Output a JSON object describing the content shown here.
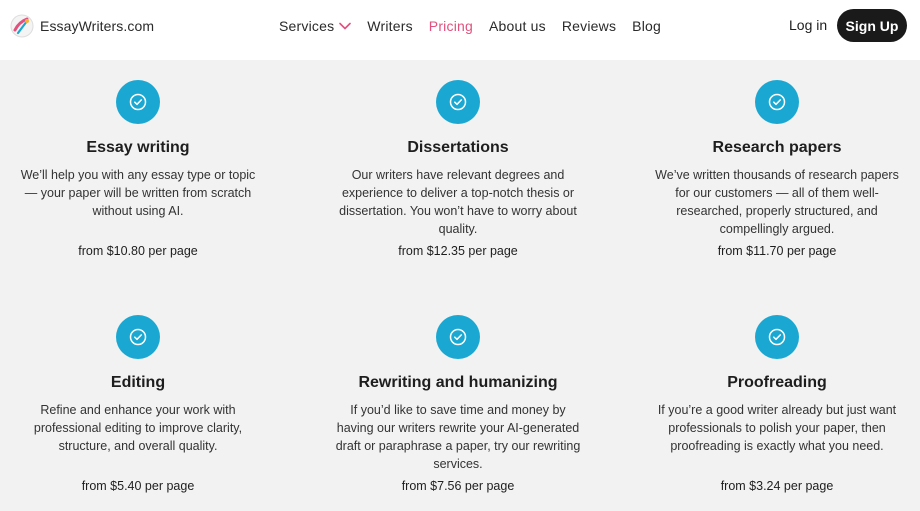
{
  "header": {
    "brand": "EssayWriters.com",
    "nav": [
      {
        "label": "Services",
        "has_dropdown": true,
        "active": false
      },
      {
        "label": "Writers",
        "has_dropdown": false,
        "active": false
      },
      {
        "label": "Pricing",
        "has_dropdown": false,
        "active": true
      },
      {
        "label": "About us",
        "has_dropdown": false,
        "active": false
      },
      {
        "label": "Reviews",
        "has_dropdown": false,
        "active": false
      },
      {
        "label": "Blog",
        "has_dropdown": false,
        "active": false
      }
    ],
    "login_label": "Log in",
    "signup_label": "Sign Up"
  },
  "colors": {
    "accent_pink": "#e2517e",
    "icon_blue": "#1aa8d2",
    "background": "#f2f2f2",
    "button_dark": "#1a1a1a"
  },
  "services": [
    {
      "title": "Essay writing",
      "description": "We’ll help you with any essay type or topic — your paper will be written from scratch without using AI.",
      "price": "from $10.80 per page",
      "icon": "check-circle-icon"
    },
    {
      "title": "Dissertations",
      "description": "Our writers have relevant degrees and experience to deliver a top-notch thesis or dissertation. You won’t have to worry about quality.",
      "price": "from $12.35 per page",
      "icon": "check-circle-icon"
    },
    {
      "title": "Research papers",
      "description": "We’ve written thousands of research papers for our customers — all of them well-researched, properly structured, and compellingly argued.",
      "price": "from $11.70 per page",
      "icon": "check-circle-icon"
    },
    {
      "title": "Editing",
      "description": "Refine and enhance your work with professional editing to improve clarity, structure, and overall quality.",
      "price": "from $5.40 per page",
      "icon": "check-circle-icon"
    },
    {
      "title": "Rewriting and humanizing",
      "description": "If you’d like to save time and money by having our writers rewrite your AI-generated draft or paraphrase a paper, try our rewriting services.",
      "price": "from $7.56 per page",
      "icon": "check-circle-icon"
    },
    {
      "title": "Proofreading",
      "description": "If you’re a good writer already but just want professionals to polish your paper, then proofreading is exactly what you need.",
      "price": "from $3.24 per page",
      "icon": "check-circle-icon"
    }
  ]
}
